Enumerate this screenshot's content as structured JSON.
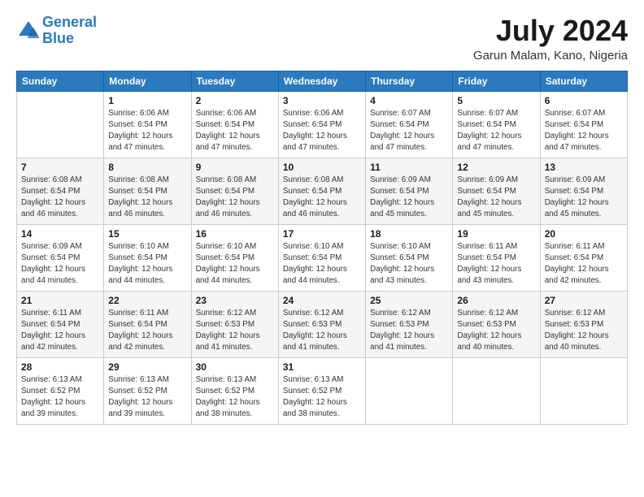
{
  "header": {
    "logo_line1": "General",
    "logo_line2": "Blue",
    "month_title": "July 2024",
    "location": "Garun Malam, Kano, Nigeria"
  },
  "days_of_week": [
    "Sunday",
    "Monday",
    "Tuesday",
    "Wednesday",
    "Thursday",
    "Friday",
    "Saturday"
  ],
  "weeks": [
    [
      {
        "day": "",
        "info": ""
      },
      {
        "day": "1",
        "info": "Sunrise: 6:06 AM\nSunset: 6:54 PM\nDaylight: 12 hours\nand 47 minutes."
      },
      {
        "day": "2",
        "info": "Sunrise: 6:06 AM\nSunset: 6:54 PM\nDaylight: 12 hours\nand 47 minutes."
      },
      {
        "day": "3",
        "info": "Sunrise: 6:06 AM\nSunset: 6:54 PM\nDaylight: 12 hours\nand 47 minutes."
      },
      {
        "day": "4",
        "info": "Sunrise: 6:07 AM\nSunset: 6:54 PM\nDaylight: 12 hours\nand 47 minutes."
      },
      {
        "day": "5",
        "info": "Sunrise: 6:07 AM\nSunset: 6:54 PM\nDaylight: 12 hours\nand 47 minutes."
      },
      {
        "day": "6",
        "info": "Sunrise: 6:07 AM\nSunset: 6:54 PM\nDaylight: 12 hours\nand 47 minutes."
      }
    ],
    [
      {
        "day": "7",
        "info": "Sunrise: 6:08 AM\nSunset: 6:54 PM\nDaylight: 12 hours\nand 46 minutes."
      },
      {
        "day": "8",
        "info": "Sunrise: 6:08 AM\nSunset: 6:54 PM\nDaylight: 12 hours\nand 46 minutes."
      },
      {
        "day": "9",
        "info": "Sunrise: 6:08 AM\nSunset: 6:54 PM\nDaylight: 12 hours\nand 46 minutes."
      },
      {
        "day": "10",
        "info": "Sunrise: 6:08 AM\nSunset: 6:54 PM\nDaylight: 12 hours\nand 46 minutes."
      },
      {
        "day": "11",
        "info": "Sunrise: 6:09 AM\nSunset: 6:54 PM\nDaylight: 12 hours\nand 45 minutes."
      },
      {
        "day": "12",
        "info": "Sunrise: 6:09 AM\nSunset: 6:54 PM\nDaylight: 12 hours\nand 45 minutes."
      },
      {
        "day": "13",
        "info": "Sunrise: 6:09 AM\nSunset: 6:54 PM\nDaylight: 12 hours\nand 45 minutes."
      }
    ],
    [
      {
        "day": "14",
        "info": "Sunrise: 6:09 AM\nSunset: 6:54 PM\nDaylight: 12 hours\nand 44 minutes."
      },
      {
        "day": "15",
        "info": "Sunrise: 6:10 AM\nSunset: 6:54 PM\nDaylight: 12 hours\nand 44 minutes."
      },
      {
        "day": "16",
        "info": "Sunrise: 6:10 AM\nSunset: 6:54 PM\nDaylight: 12 hours\nand 44 minutes."
      },
      {
        "day": "17",
        "info": "Sunrise: 6:10 AM\nSunset: 6:54 PM\nDaylight: 12 hours\nand 44 minutes."
      },
      {
        "day": "18",
        "info": "Sunrise: 6:10 AM\nSunset: 6:54 PM\nDaylight: 12 hours\nand 43 minutes."
      },
      {
        "day": "19",
        "info": "Sunrise: 6:11 AM\nSunset: 6:54 PM\nDaylight: 12 hours\nand 43 minutes."
      },
      {
        "day": "20",
        "info": "Sunrise: 6:11 AM\nSunset: 6:54 PM\nDaylight: 12 hours\nand 42 minutes."
      }
    ],
    [
      {
        "day": "21",
        "info": "Sunrise: 6:11 AM\nSunset: 6:54 PM\nDaylight: 12 hours\nand 42 minutes."
      },
      {
        "day": "22",
        "info": "Sunrise: 6:11 AM\nSunset: 6:54 PM\nDaylight: 12 hours\nand 42 minutes."
      },
      {
        "day": "23",
        "info": "Sunrise: 6:12 AM\nSunset: 6:53 PM\nDaylight: 12 hours\nand 41 minutes."
      },
      {
        "day": "24",
        "info": "Sunrise: 6:12 AM\nSunset: 6:53 PM\nDaylight: 12 hours\nand 41 minutes."
      },
      {
        "day": "25",
        "info": "Sunrise: 6:12 AM\nSunset: 6:53 PM\nDaylight: 12 hours\nand 41 minutes."
      },
      {
        "day": "26",
        "info": "Sunrise: 6:12 AM\nSunset: 6:53 PM\nDaylight: 12 hours\nand 40 minutes."
      },
      {
        "day": "27",
        "info": "Sunrise: 6:12 AM\nSunset: 6:53 PM\nDaylight: 12 hours\nand 40 minutes."
      }
    ],
    [
      {
        "day": "28",
        "info": "Sunrise: 6:13 AM\nSunset: 6:52 PM\nDaylight: 12 hours\nand 39 minutes."
      },
      {
        "day": "29",
        "info": "Sunrise: 6:13 AM\nSunset: 6:52 PM\nDaylight: 12 hours\nand 39 minutes."
      },
      {
        "day": "30",
        "info": "Sunrise: 6:13 AM\nSunset: 6:52 PM\nDaylight: 12 hours\nand 38 minutes."
      },
      {
        "day": "31",
        "info": "Sunrise: 6:13 AM\nSunset: 6:52 PM\nDaylight: 12 hours\nand 38 minutes."
      },
      {
        "day": "",
        "info": ""
      },
      {
        "day": "",
        "info": ""
      },
      {
        "day": "",
        "info": ""
      }
    ]
  ]
}
